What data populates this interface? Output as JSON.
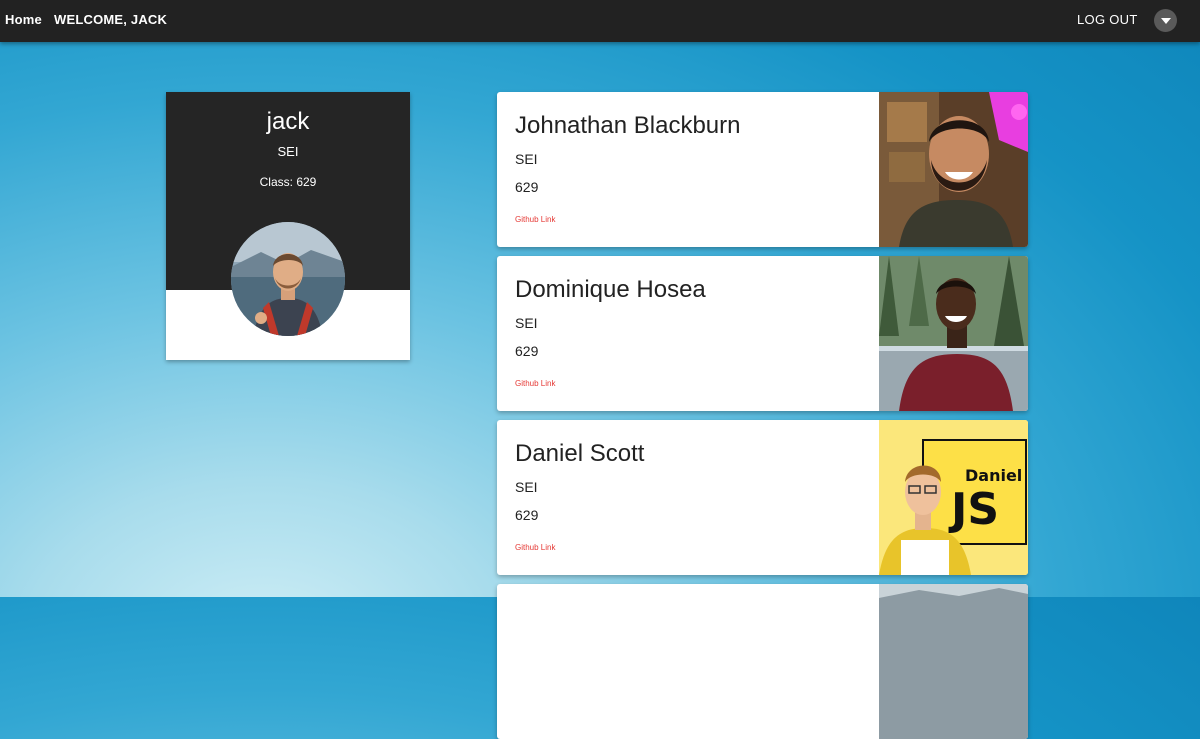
{
  "navbar": {
    "home_label": "Home",
    "welcome_label": "WELCOME, JACK",
    "logout_label": "LOG OUT",
    "dropdown_icon": "caret-down-icon"
  },
  "profile": {
    "name": "jack",
    "program": "SEI",
    "class_label": "Class: 629",
    "avatar": "profile-photo"
  },
  "students": [
    {
      "name": "Johnathan Blackburn",
      "program": "SEI",
      "class": "629",
      "link_label": "Github Link",
      "photo": "student-photo"
    },
    {
      "name": "Dominique Hosea",
      "program": "SEI",
      "class": "629",
      "link_label": "Github Link",
      "photo": "student-photo"
    },
    {
      "name": "Daniel Scott",
      "program": "SEI",
      "class": "629",
      "link_label": "Github Link",
      "photo_text_1": "Daniel",
      "photo_text_2": "JS",
      "photo": "student-photo"
    }
  ],
  "colors": {
    "navbar": "#222222",
    "profile_header": "#252525",
    "link": "#e53935",
    "badge": "#fde047"
  }
}
